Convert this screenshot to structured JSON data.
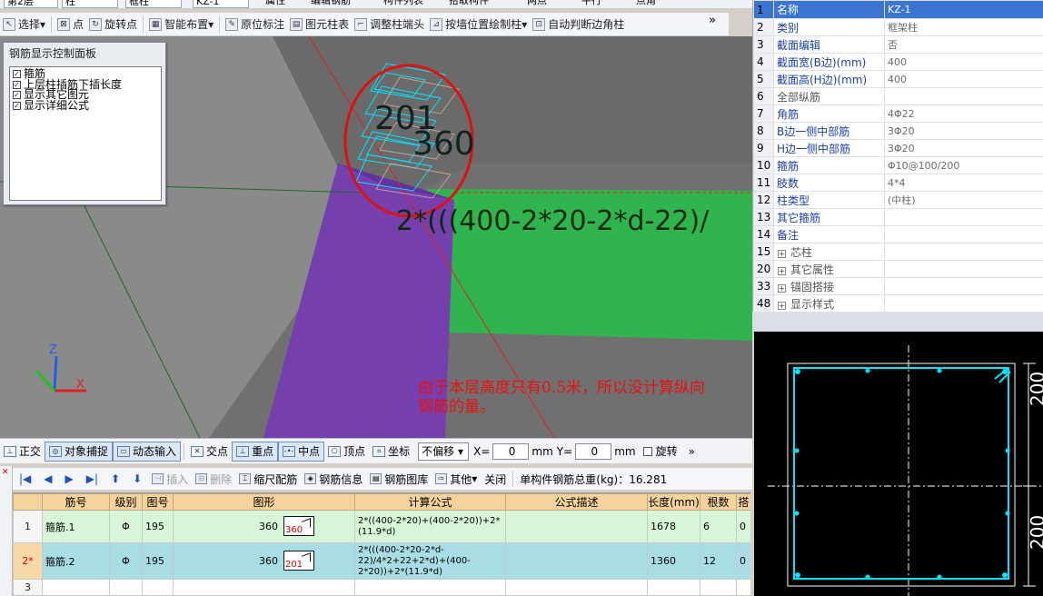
{
  "topbar": {
    "floor": "第2层",
    "type": "柱",
    "sub": "框柱",
    "member": "KZ-1",
    "attr_label": "属性",
    "edit_label": "编辑钢筋",
    "list_label": "构件列表",
    "pick_label": "拾取构件",
    "twopoint_label": "两点",
    "parallel_label": "平行",
    "angle_label": "点角"
  },
  "toolbar": {
    "items": [
      "选择",
      "点",
      "旋转点",
      "智能布置",
      "原位标注",
      "图元柱表",
      "调整柱端头",
      "按墙位置绘制柱",
      "自动判断边角柱"
    ],
    "more": "»"
  },
  "display_panel": {
    "title": "钢筋显示控制面板",
    "options": [
      {
        "label": "箍筋",
        "checked": true
      },
      {
        "label": "上层柱插筋下插长度",
        "checked": true
      },
      {
        "label": "显示其它图元",
        "checked": true
      },
      {
        "label": "显示详细公式",
        "checked": true
      }
    ]
  },
  "viewport": {
    "label_a": "201",
    "label_b": "360",
    "formula": "2*(((400-2*20-2*d-22)/",
    "note_line1": "由于本层高度只有0.5米，所以没计算纵向",
    "note_line2": "钢筋的量。",
    "axis_x": "X",
    "axis_z": "Z"
  },
  "snapbar": {
    "items": [
      "正交",
      "对象捕捉",
      "动态输入",
      "交点",
      "重点",
      "中点",
      "顶点",
      "坐标"
    ],
    "offset_mode": "不偏移",
    "x_label": "X=",
    "x_value": "0",
    "y_label": "Y=",
    "y_value": "0",
    "unit": "mm",
    "rotate_label": "旋转",
    "more": "»"
  },
  "gridbar": {
    "insert": "插入",
    "delete": "删除",
    "scale": "缩尺配筋",
    "info": "钢筋信息",
    "library": "钢筋图库",
    "other": "其他",
    "close": "关闭",
    "total": "单构件钢筋总重(kg)：16.281"
  },
  "rebar_table": {
    "headers": [
      "",
      "筋号",
      "级别",
      "图号",
      "图形",
      "计算公式",
      "公式描述",
      "长度(mm)",
      "根数",
      "搭"
    ],
    "rows": [
      {
        "idx": "1",
        "name": "箍筋.1",
        "grade": "Φ",
        "fig": "195",
        "dim": "360",
        "shape_label": "360",
        "formula": "2*((400-2*20)+(400-2*20))+2*(11.9*d)",
        "desc": "",
        "length": "1678",
        "count": "6",
        "lap": "0"
      },
      {
        "idx": "2*",
        "name": "箍筋.2",
        "grade": "Φ",
        "fig": "195",
        "dim": "360",
        "shape_label": "201",
        "formula": "2*(((400-2*20-2*d-22)/4*2+22+2*d)+(400-2*20))+2*(11.9*d)",
        "desc": "",
        "length": "1360",
        "count": "12",
        "lap": "0"
      },
      {
        "idx": "3",
        "name": "",
        "grade": "",
        "fig": "",
        "dim": "",
        "shape_label": "",
        "formula": "",
        "desc": "",
        "length": "",
        "count": "",
        "lap": ""
      }
    ]
  },
  "properties": {
    "rows": [
      {
        "n": "1",
        "key": "名称",
        "val": "KZ-1",
        "selected": true
      },
      {
        "n": "2",
        "key": "类别",
        "val": "框架柱"
      },
      {
        "n": "3",
        "key": "截面编辑",
        "val": "否"
      },
      {
        "n": "4",
        "key": "截面宽(B边)(mm)",
        "val": "400"
      },
      {
        "n": "5",
        "key": "截面高(H边)(mm)",
        "val": "400"
      },
      {
        "n": "6",
        "key": "全部纵筋",
        "val": "",
        "plain": true
      },
      {
        "n": "7",
        "key": "角筋",
        "val": "4Φ22"
      },
      {
        "n": "8",
        "key": "B边一侧中部筋",
        "val": "3Φ20"
      },
      {
        "n": "9",
        "key": "H边一侧中部筋",
        "val": "3Φ20"
      },
      {
        "n": "10",
        "key": "箍筋",
        "val": "Φ10@100/200"
      },
      {
        "n": "11",
        "key": "肢数",
        "val": "4*4"
      },
      {
        "n": "12",
        "key": "柱类型",
        "val": "(中柱)"
      },
      {
        "n": "13",
        "key": "其它箍筋",
        "val": ""
      },
      {
        "n": "14",
        "key": "备注",
        "val": ""
      },
      {
        "n": "15",
        "key": "芯柱",
        "val": "",
        "group": true
      },
      {
        "n": "20",
        "key": "其它属性",
        "val": "",
        "group": true
      },
      {
        "n": "33",
        "key": "锚固搭接",
        "val": "",
        "group": true
      },
      {
        "n": "48",
        "key": "显示样式",
        "val": "",
        "group": true
      }
    ]
  },
  "preview": {
    "dim_top": "200",
    "dim_bottom": "200"
  },
  "colors": {
    "cyan": "#00e5ff",
    "purple": "#7b3fb2",
    "green": "#2db34a",
    "red": "#e01010"
  }
}
